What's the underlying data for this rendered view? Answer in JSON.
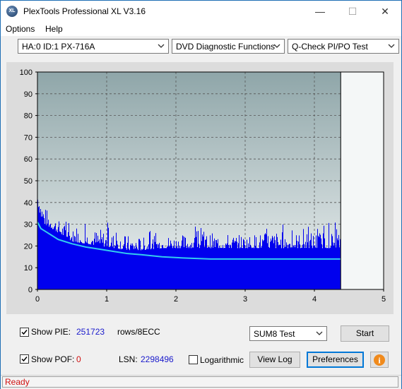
{
  "window": {
    "title": "PlexTools Professional XL V3.16",
    "icon_text": "XL",
    "minimize": "—",
    "maximize": "☐",
    "close": "✕"
  },
  "menu": {
    "options": "Options",
    "help": "Help"
  },
  "toolbar": {
    "drive": "HA:0 ID:1  PX-716A",
    "function": "DVD Diagnostic Functions",
    "test": "Q-Check PI/PO Test"
  },
  "chart_data": {
    "type": "area",
    "x_ticks": [
      "0",
      "1",
      "2",
      "3",
      "4",
      "5"
    ],
    "y_ticks": [
      "0",
      "10",
      "20",
      "30",
      "40",
      "50",
      "60",
      "70",
      "80",
      "90",
      "100"
    ],
    "xlim": [
      0,
      5
    ],
    "ylim": [
      0,
      100
    ],
    "grid": true,
    "end_marker_x": 4.38,
    "series": [
      {
        "kind": "PIE bars",
        "color": "#0000ee",
        "x": [
          0.0,
          0.05,
          0.1,
          0.2,
          0.3,
          0.4,
          0.5,
          0.7,
          0.9,
          1.1,
          1.3,
          1.5,
          1.8,
          2.0,
          2.3,
          2.6,
          3.0,
          3.4,
          3.8,
          4.1,
          4.38
        ],
        "base": [
          39,
          33,
          30,
          28,
          26,
          24,
          22,
          21,
          20,
          19,
          18,
          18,
          19,
          19,
          19,
          19,
          19,
          19,
          19,
          19,
          19
        ],
        "peak": [
          50,
          42,
          38,
          35,
          32,
          30,
          28,
          27,
          28,
          26,
          25,
          24,
          25,
          25,
          26,
          26,
          25,
          27,
          26,
          27,
          27
        ]
      },
      {
        "kind": "average line",
        "color": "#33ccee",
        "x": [
          0.0,
          0.05,
          0.1,
          0.2,
          0.3,
          0.4,
          0.5,
          0.7,
          0.9,
          1.1,
          1.3,
          1.5,
          1.8,
          2.1,
          2.5,
          3.0,
          3.5,
          4.0,
          4.38
        ],
        "y": [
          31,
          28,
          27,
          25,
          23,
          22,
          21,
          19.5,
          18.5,
          17.5,
          16.5,
          16,
          15,
          14.5,
          14,
          14,
          14,
          14,
          14
        ]
      }
    ]
  },
  "bottom": {
    "show_pie_label": "Show PIE:",
    "pie_value": "251723",
    "rows_label": "rows/8ECC",
    "show_pof_label": "Show POF:",
    "pof_value": "0",
    "lsn_label": "LSN:",
    "lsn_value": "2298496",
    "logarithmic_label": "Logarithmic",
    "sum8_select": "SUM8 Test",
    "start_button": "Start",
    "view_log_button": "View Log",
    "preferences_button": "Preferences",
    "info_icon": "i"
  },
  "status": {
    "text": "Ready"
  }
}
